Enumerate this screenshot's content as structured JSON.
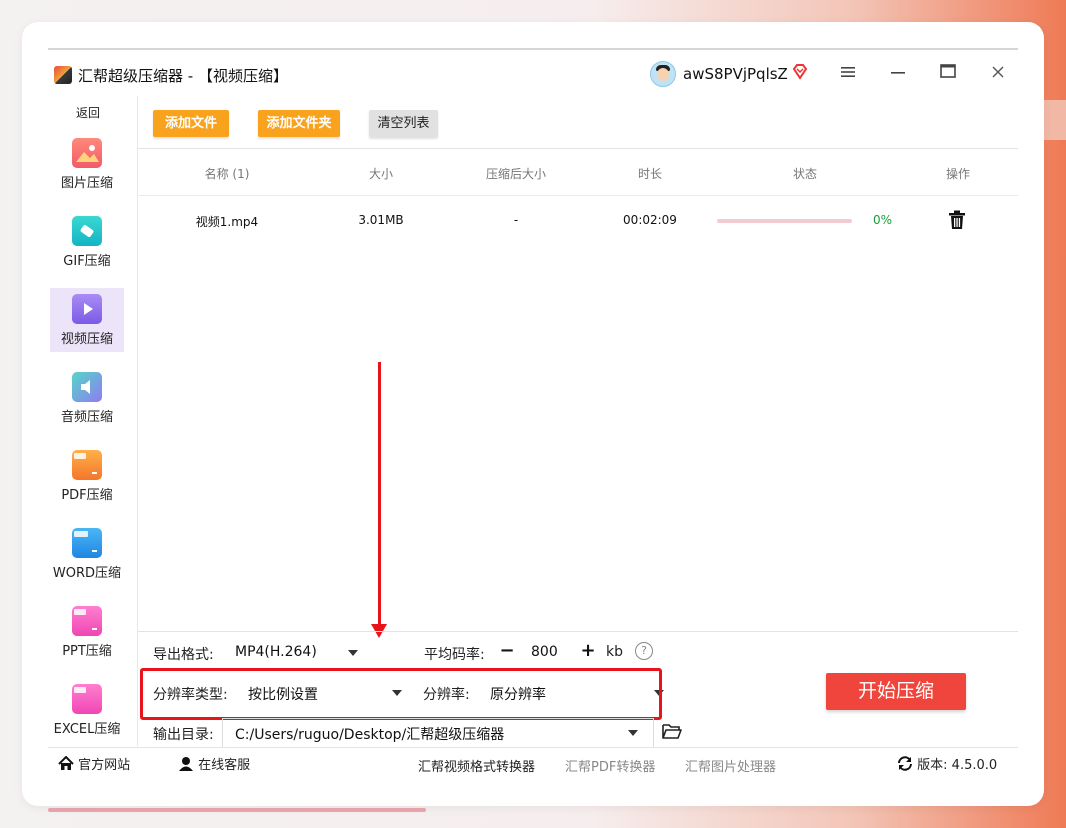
{
  "window": {
    "app_name": "汇帮超级压缩器",
    "separator": " - ",
    "page": "【视频压缩】",
    "username": "awS8PVjPqlsZ"
  },
  "sidebar": {
    "back_label": "返回",
    "items": [
      {
        "label": "图片压缩",
        "icon": "image-icon",
        "active": false
      },
      {
        "label": "GIF压缩",
        "icon": "gif-icon",
        "active": false
      },
      {
        "label": "视频压缩",
        "icon": "video-icon",
        "active": true
      },
      {
        "label": "音频压缩",
        "icon": "audio-icon",
        "active": false
      },
      {
        "label": "PDF压缩",
        "icon": "pdf-icon",
        "active": false
      },
      {
        "label": "WORD压缩",
        "icon": "word-icon",
        "active": false
      },
      {
        "label": "PPT压缩",
        "icon": "ppt-icon",
        "active": false
      },
      {
        "label": "EXCEL压缩",
        "icon": "excel-icon",
        "active": false
      }
    ]
  },
  "toolbar": {
    "add_file": "添加文件",
    "add_folder": "添加文件夹",
    "clear_list": "清空列表"
  },
  "table": {
    "headers": [
      "名称 (1)",
      "大小",
      "压缩后大小",
      "时长",
      "状态",
      "操作"
    ],
    "rows": [
      {
        "name": "视频1.mp4",
        "size": "3.01MB",
        "compressed_size": "-",
        "duration": "00:02:09",
        "progress": 0,
        "progress_text": "0%"
      }
    ]
  },
  "settings": {
    "format_label": "导出格式:",
    "format_value": "MP4(H.264)",
    "bitrate_label": "平均码率:",
    "bitrate_minus": "−",
    "bitrate_value": "800",
    "bitrate_plus": "+",
    "bitrate_unit": "kb",
    "help_icon": "?",
    "resolution_type_label": "分辨率类型:",
    "resolution_type_value": "按比例设置",
    "resolution_label": "分辨率:",
    "resolution_value": "原分辨率",
    "output_label": "输出目录:",
    "output_value": "C:/Users/ruguo/Desktop/汇帮超级压缩器",
    "start_button": "开始压缩"
  },
  "footer": {
    "official_site": "官方网站",
    "online_service": "在线客服",
    "link_video_converter": "汇帮视频格式转换器",
    "link_pdf_converter": "汇帮PDF转换器",
    "link_image_processor": "汇帮图片处理器",
    "version_label": "版本:",
    "version_value": "4.5.0.0"
  },
  "colors": {
    "accent_orange": "#f9a21e",
    "start_red": "#f0453c",
    "highlight_red": "#e8141a",
    "active_nav": "#ece4f8",
    "progress_green": "#1a9e3a"
  }
}
